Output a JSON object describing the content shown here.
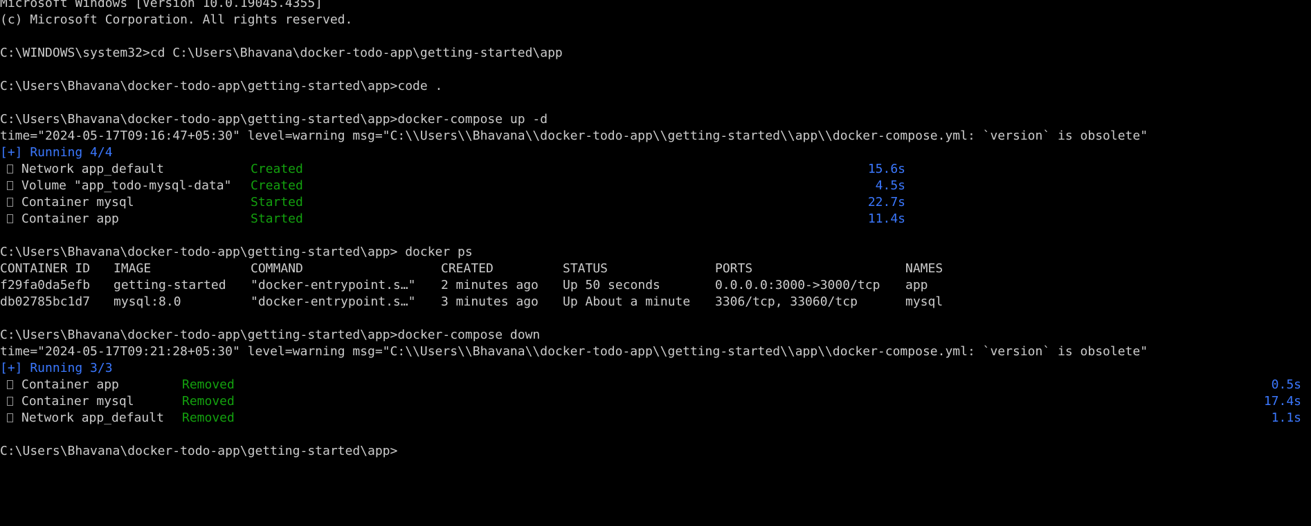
{
  "terminal": {
    "banner": {
      "version_line": "Microsoft Windows [Version 10.0.19045.4355]",
      "copyright_line": "(c) Microsoft Corporation. All rights reserved."
    },
    "cmd_cd": "C:\\WINDOWS\\system32>cd C:\\Users\\Bhavana\\docker-todo-app\\getting-started\\app",
    "cmd_code": "C:\\Users\\Bhavana\\docker-todo-app\\getting-started\\app>code .",
    "cmd_up": "C:\\Users\\Bhavana\\docker-todo-app\\getting-started\\app>docker-compose up -d",
    "up_warning": "time=\"2024-05-17T09:16:47+05:30\" level=warning msg=\"C:\\\\Users\\\\Bhavana\\\\docker-todo-app\\\\getting-started\\\\app\\\\docker-compose.yml: `version` is obsolete\"",
    "up_running": "[+] Running 4/4",
    "up_items": [
      {
        "name": "Network app_default",
        "status": "Created",
        "time": "15.6s"
      },
      {
        "name": "Volume \"app_todo-mysql-data\"",
        "status": "Created",
        "time": "4.5s"
      },
      {
        "name": "Container mysql",
        "status": "Started",
        "time": "22.7s"
      },
      {
        "name": "Container app",
        "status": "Started",
        "time": "11.4s"
      }
    ],
    "cmd_ps": "C:\\Users\\Bhavana\\docker-todo-app\\getting-started\\app> docker ps",
    "ps_table": {
      "headers": [
        "CONTAINER ID",
        "IMAGE",
        "COMMAND",
        "CREATED",
        "STATUS",
        "PORTS",
        "NAMES"
      ],
      "rows": [
        [
          "f29fa0da5efb",
          "getting-started",
          "\"docker-entrypoint.s…\"",
          "2 minutes ago",
          "Up 50 seconds",
          "0.0.0.0:3000->3000/tcp",
          "app"
        ],
        [
          "db02785bc1d7",
          "mysql:8.0",
          "\"docker-entrypoint.s…\"",
          "3 minutes ago",
          "Up About a minute",
          "3306/tcp, 33060/tcp",
          "mysql"
        ]
      ]
    },
    "cmd_down": "C:\\Users\\Bhavana\\docker-todo-app\\getting-started\\app>docker-compose down",
    "down_warning": "time=\"2024-05-17T09:21:28+05:30\" level=warning msg=\"C:\\\\Users\\\\Bhavana\\\\docker-todo-app\\\\getting-started\\\\app\\\\docker-compose.yml: `version` is obsolete\"",
    "down_running": "[+] Running 3/3",
    "down_items": [
      {
        "name": "Container app",
        "status": "Removed",
        "time": "0.5s"
      },
      {
        "name": "Container mysql",
        "status": "Removed",
        "time": "17.4s"
      },
      {
        "name": "Network app_default",
        "status": "Removed",
        "time": "1.1s"
      }
    ],
    "final_prompt": "C:\\Users\\Bhavana\\docker-todo-app\\getting-started\\app>"
  },
  "colors": {
    "background": "#000000",
    "text": "#cccccc",
    "status_green": "#13a10e",
    "timing_blue": "#3b78ff"
  },
  "icons": {
    "status_box": "unknown-glyph-box-icon"
  }
}
